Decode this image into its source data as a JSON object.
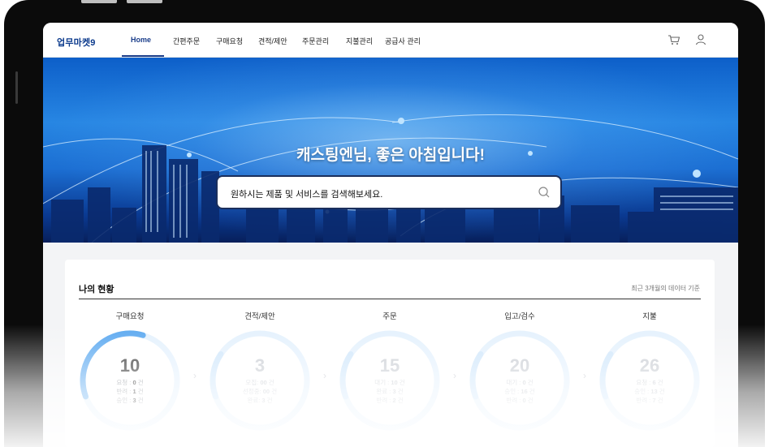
{
  "nav": {
    "logo": "업무마켓9",
    "items": [
      {
        "label": "Home",
        "active": true
      },
      {
        "label": "간편주문"
      },
      {
        "label": "구매요청"
      },
      {
        "label": "견적/제안"
      },
      {
        "label": "주문관리"
      },
      {
        "label": "지불관리"
      },
      {
        "label": "공급사 관리"
      }
    ],
    "icons": [
      "cart-icon",
      "user-icon"
    ]
  },
  "hero": {
    "title": "캐스팅엔님, 좋은 아침입니다!",
    "search_placeholder": "원하시는 제품 및 서비스를 검색해보세요."
  },
  "status": {
    "title": "나의 현황",
    "note": "최근 3개월의 데이터 기준",
    "cards": [
      {
        "label": "구매요청",
        "total": "10",
        "progress": 0.35,
        "lines": [
          {
            "k": "요청 :",
            "v": "0",
            "u": "건"
          },
          {
            "k": "반려 :",
            "v": "1",
            "u": "건"
          },
          {
            "k": "승인 :",
            "v": "3",
            "u": "건"
          }
        ]
      },
      {
        "label": "견적/제안",
        "total": "3",
        "progress": 0.15,
        "lines": [
          {
            "k": "모집:",
            "v": "00",
            "u": "건"
          },
          {
            "k": "선정중:",
            "v": "00",
            "u": "건"
          },
          {
            "k": "완료:",
            "v": "3",
            "u": "건"
          }
        ]
      },
      {
        "label": "주문",
        "total": "15",
        "progress": 0.15,
        "lines": [
          {
            "k": "대기 :",
            "v": "10",
            "u": "건"
          },
          {
            "k": "완료 :",
            "v": "3",
            "u": "건"
          },
          {
            "k": "반려 :",
            "v": "2",
            "u": "건"
          }
        ]
      },
      {
        "label": "입고/검수",
        "total": "20",
        "progress": 0.15,
        "lines": [
          {
            "k": "대기 :",
            "v": "0",
            "u": "건"
          },
          {
            "k": "승인 :",
            "v": "16",
            "u": "건"
          },
          {
            "k": "반려 :",
            "v": "0",
            "u": "건"
          }
        ]
      },
      {
        "label": "지불",
        "total": "26",
        "progress": 0.15,
        "lines": [
          {
            "k": "요청 :",
            "v": "6",
            "u": "건"
          },
          {
            "k": "승인 :",
            "v": "13",
            "u": "건"
          },
          {
            "k": "반려 :",
            "v": "7",
            "u": "건"
          }
        ]
      }
    ]
  },
  "colors": {
    "accent": "#1a3d8a",
    "ring_active": "#5aa8f0",
    "ring_track": "#e4f1fd"
  }
}
